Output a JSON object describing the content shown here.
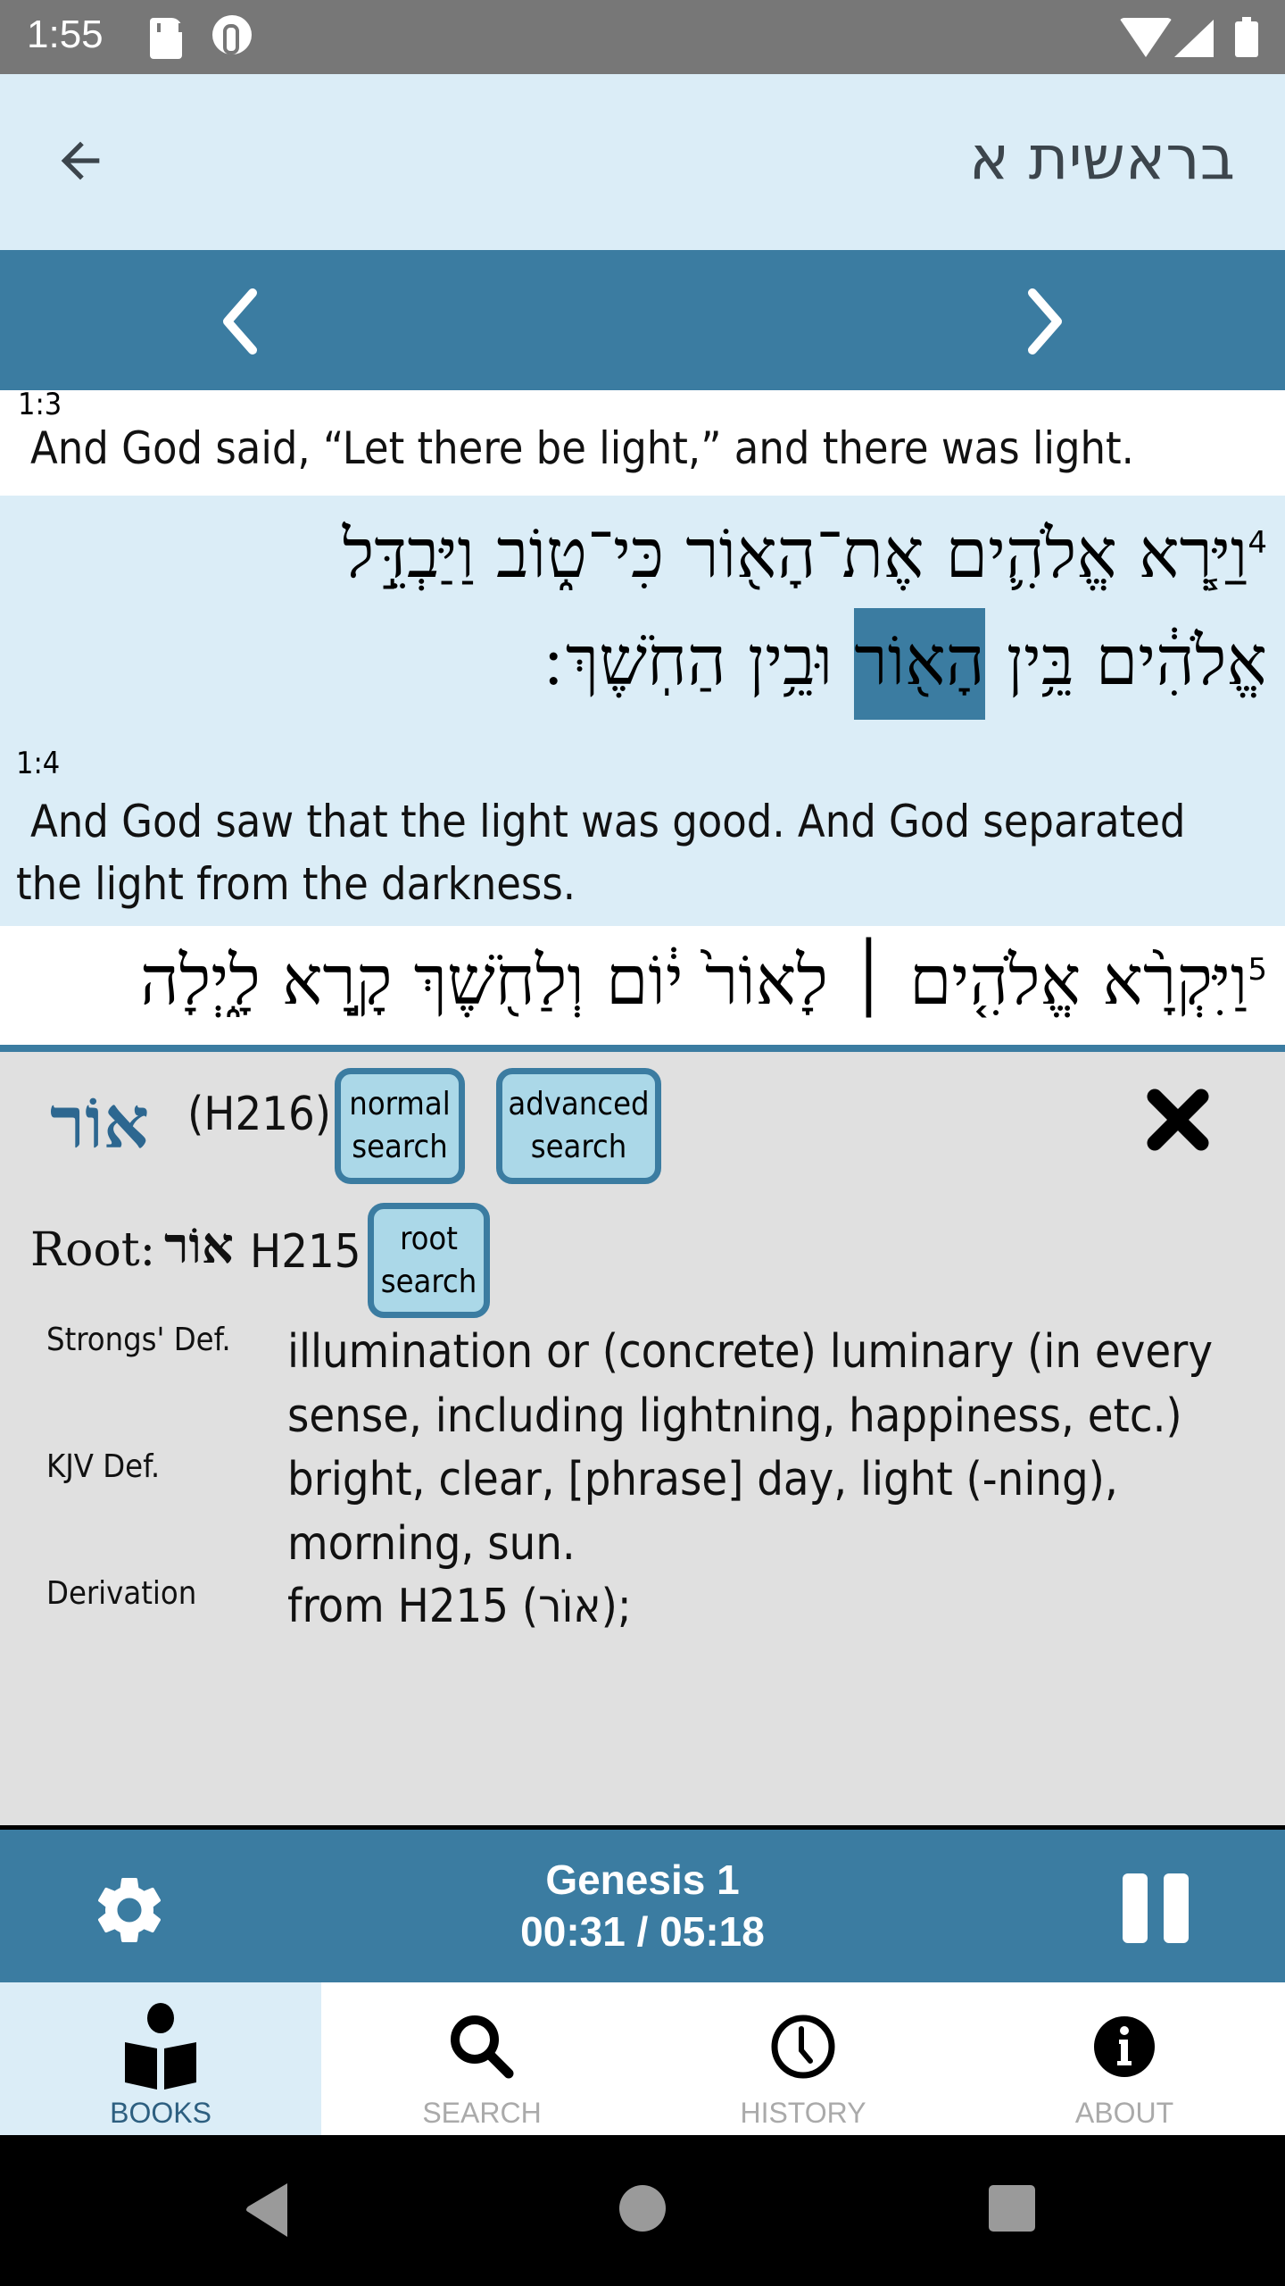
{
  "status_bar": {
    "time": "1:55",
    "icons": [
      "sd-card-icon",
      "sync-icon",
      "wifi-icon",
      "signal-icon",
      "battery-icon"
    ]
  },
  "app_bar": {
    "back_icon": "arrow-left-icon",
    "title": "בראשית א"
  },
  "chapter_nav": {
    "prev_icon": "chevron-left-icon",
    "next_icon": "chevron-right-icon"
  },
  "verses": [
    {
      "ref": "1:3",
      "english": "And God said, “Let there be light,” and there was light."
    },
    {
      "number": "4",
      "hebrew_line1": "וַיַּ֧רְא אֱלֹהִ֛ים אֶת־הָא֖וֹר כִּי־ט֑וֹב וַיַּבְדֵּ֣ל",
      "hebrew_line2_before": "אֱלֹהִ֔ים בֵּ֥ין",
      "hebrew_highlight": "הָא֖וֹר",
      "hebrew_line2_after": "וּבֵ֥ין הַחֹֽשֶׁךְ ׃",
      "ref": "1:4",
      "english": "And God saw that the light was good. And God separated the light from the darkness."
    },
    {
      "number": "5",
      "hebrew_line1": "וַיִּקְרָ֨א אֱלֹהִ֤ים ׀ לָאוֹר֙ י֔וֹם וְלַחֹ֖שֶׁךְ קָ֣רָא לָ֑יְלָה"
    }
  ],
  "lexicon": {
    "word": "אוֹר",
    "strongs": "(H216)",
    "buttons": {
      "normal_search": "normal search",
      "advanced_search": "advanced search",
      "root_search": "root search"
    },
    "close_icon": "close-icon",
    "root_label": "Root:",
    "root_word": "אוֹר",
    "root_strongs": "H215",
    "definitions": [
      {
        "label": "Strongs' Def.",
        "value": "illumination or (concrete) luminary (in every sense, including lightning, happiness, etc.)"
      },
      {
        "label": "KJV Def.",
        "value": "bright, clear, [phrase] day, light (-ning), morning, sun."
      },
      {
        "label": "Derivation",
        "value": "from H215 (אוֹר);"
      }
    ]
  },
  "player": {
    "title": "Genesis 1",
    "elapsed": "00:31",
    "duration": "05:18",
    "time_display": "00:31 / 05:18",
    "state": "playing",
    "settings_icon": "gear-icon",
    "pause_icon": "pause-icon"
  },
  "tabs": [
    {
      "label": "BOOKS",
      "icon": "book-reader-icon",
      "active": true
    },
    {
      "label": "SEARCH",
      "icon": "search-icon",
      "active": false
    },
    {
      "label": "HISTORY",
      "icon": "clock-icon",
      "active": false
    },
    {
      "label": "ABOUT",
      "icon": "info-icon",
      "active": false
    }
  ],
  "colors": {
    "primary": "#3b7ca1",
    "light_blue": "#dbedf7",
    "panel_grey": "#e0e0e0",
    "button_fill": "#abd8e8",
    "lexicon_word": "#2d6790",
    "active_tab_label": "#2d5f80",
    "inactive_tab_label": "#aaaaaa"
  }
}
